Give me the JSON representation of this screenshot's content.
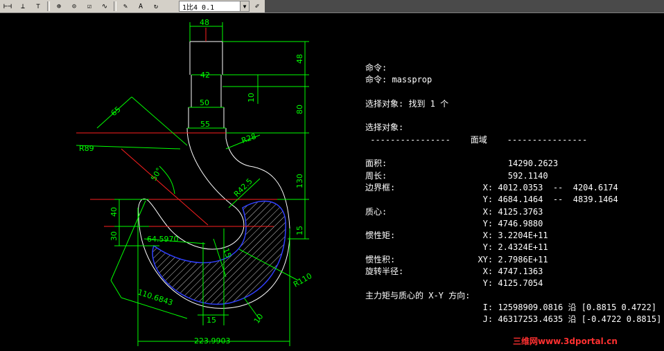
{
  "toolbar": {
    "scale_value": "1比4 0.1",
    "icons": [
      "linear-dim-icon",
      "aligned-dim-icon",
      "ordinate-dim-icon",
      "tolerance-icon",
      "center-mark-icon",
      "inspect-icon",
      "jogged-icon",
      "dimedit-icon",
      "dimtedit-icon",
      "update-dim-icon",
      "dimstyle-icon"
    ]
  },
  "drawing": {
    "dims": {
      "d48_top": "48",
      "d48_side": "48",
      "d42": "42",
      "d10": "10",
      "d50": "50",
      "d80": "80",
      "d55": "55",
      "d65": "65",
      "r89": "R89",
      "r28": "R28",
      "a50": "50°",
      "r42_5": "R42.5",
      "d130": "130",
      "d40": "40",
      "d30": "30",
      "d64": "64.5970",
      "d15_right": "15",
      "d15_diag": "15",
      "r110": "R110",
      "d110": "110.6843",
      "d15_bottom": "15",
      "d10_bottom": "10",
      "d223": "223.9903"
    }
  },
  "report": {
    "lines": [
      {
        "c1": "命令:",
        "c2": ""
      },
      {
        "c1": "命令: massprop",
        "c2": ""
      },
      {
        "c1": "",
        "c2": ""
      },
      {
        "c1": "选择对象: 找到 1 个",
        "c2": ""
      },
      {
        "c1": "",
        "c2": ""
      },
      {
        "c1": "选择对象:",
        "c2": ""
      },
      {
        "c1": " ----------------    面域    ----------------",
        "c2": ""
      },
      {
        "c1": "",
        "c2": ""
      },
      {
        "c1": "面积:",
        "c2": "        14290.2623"
      },
      {
        "c1": "周长:",
        "c2": "        592.1140"
      },
      {
        "c1": "边界框:",
        "c2": "   X: 4012.0353  --  4204.6174"
      },
      {
        "c1": "",
        "c2": "   Y: 4684.1464  --  4839.1464"
      },
      {
        "c1": "质心:",
        "c2": "   X: 4125.3763"
      },
      {
        "c1": "",
        "c2": "   Y: 4746.9880"
      },
      {
        "c1": "惯性矩:",
        "c2": "   X: 3.2204E+11"
      },
      {
        "c1": "",
        "c2": "   Y: 2.4324E+11"
      },
      {
        "c1": "惯性积:",
        "c2": "  XY: 2.7986E+11"
      },
      {
        "c1": "旋转半径:",
        "c2": "   X: 4747.1363"
      },
      {
        "c1": "",
        "c2": "   Y: 4125.7054"
      },
      {
        "c1": "主力矩与质心的 X-Y 方向:",
        "c2": ""
      },
      {
        "c1": "",
        "c2": "   I: 12598909.0816 沿 [0.8815 0.4722]"
      },
      {
        "c1": "",
        "c2": "   J: 46317253.4635 沿 [-0.4722 0.8815]"
      }
    ]
  },
  "watermark": "三维网www.3dportal.cn"
}
